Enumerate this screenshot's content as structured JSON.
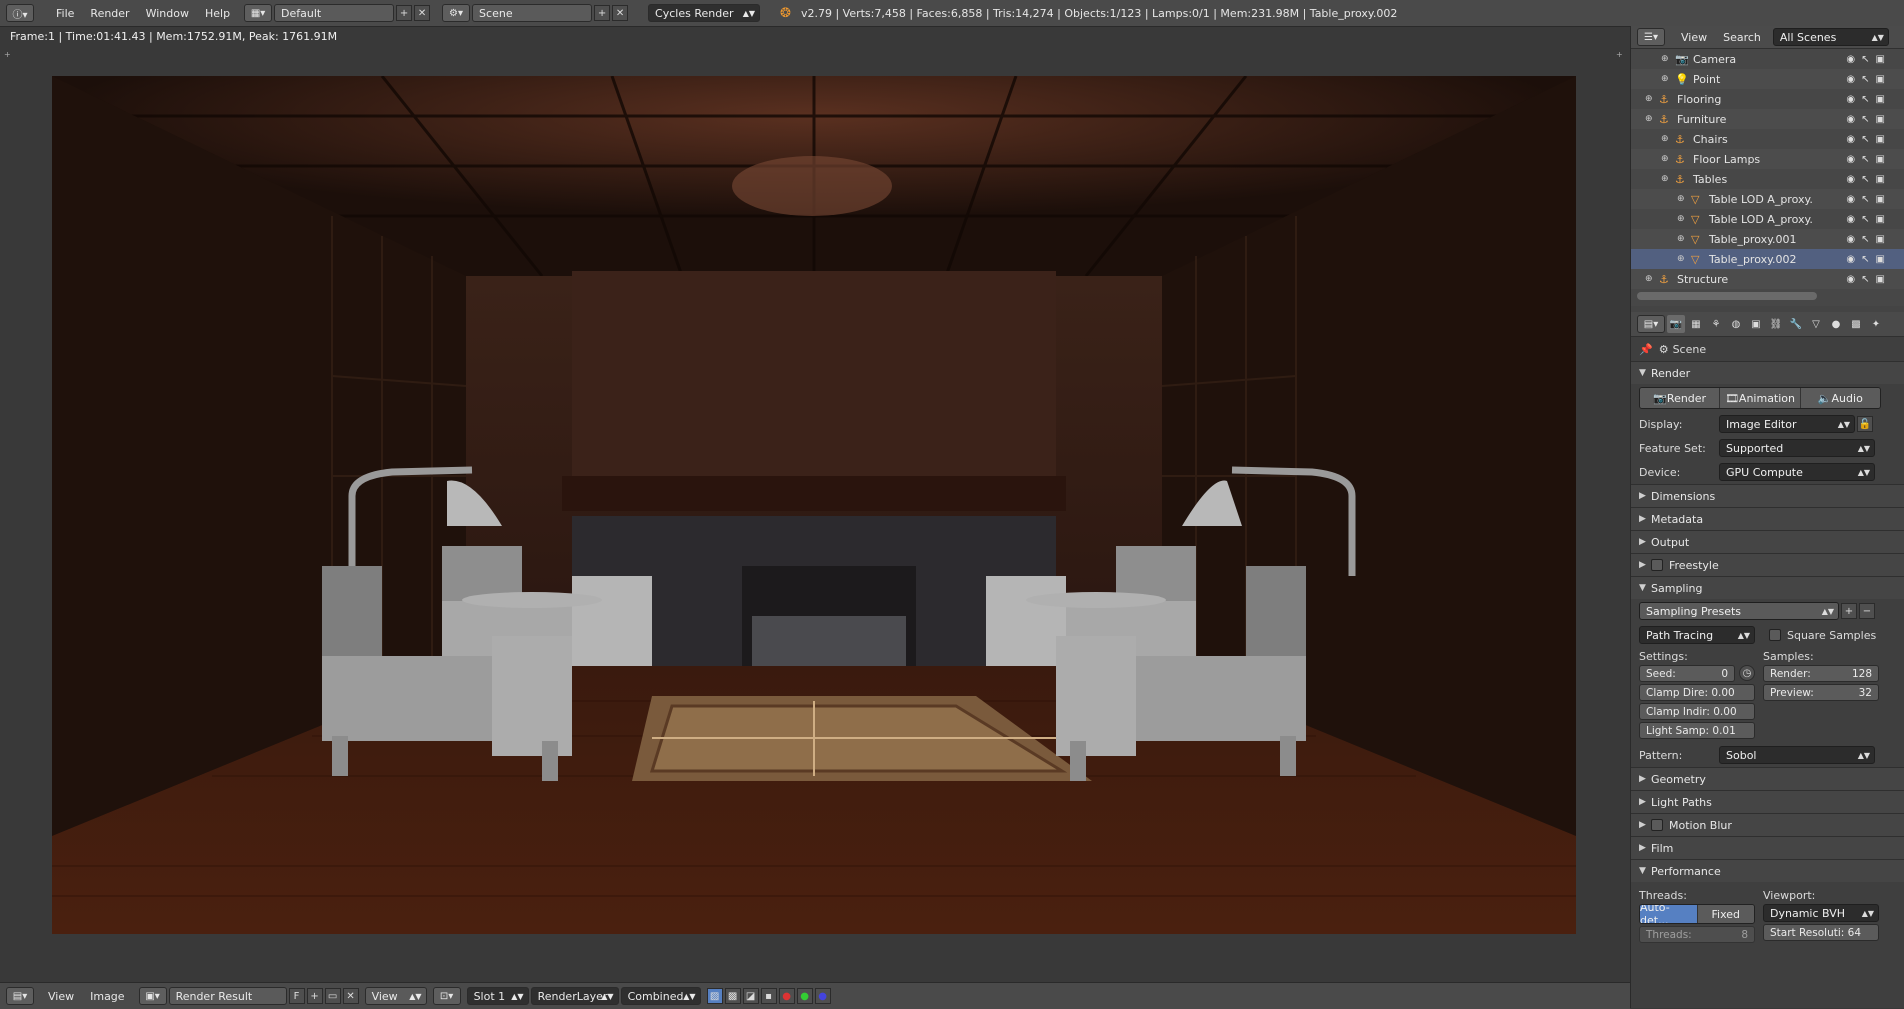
{
  "topbar": {
    "menus": [
      "File",
      "Render",
      "Window",
      "Help"
    ],
    "layout_name": "Default",
    "scene_name": "Scene",
    "engine": "Cycles Render",
    "stats": "v2.79 | Verts:7,458 | Faces:6,858 | Tris:14,274 | Objects:1/123 | Lamps:0/1 | Mem:231.98M | Table_proxy.002"
  },
  "image_editor": {
    "frame_info": "Frame:1 | Time:01:41.43 | Mem:1752.91M, Peak: 1761.91M"
  },
  "bottombar": {
    "view_label": "View",
    "image_label": "Image",
    "image_name": "Render Result",
    "fake_user": "F",
    "view_dropdown": "View",
    "slot": "Slot 1",
    "render_layer": "RenderLayer",
    "pass": "Combined"
  },
  "outliner": {
    "view_label": "View",
    "search_label": "Search",
    "filter": "All Scenes",
    "items": [
      {
        "label": "Camera",
        "indent": 2,
        "icon": "camera-icon"
      },
      {
        "label": "Point",
        "indent": 2,
        "icon": "lamp-icon"
      },
      {
        "label": "Flooring",
        "indent": 1,
        "icon": "empty-icon"
      },
      {
        "label": "Furniture",
        "indent": 1,
        "icon": "empty-icon"
      },
      {
        "label": "Chairs",
        "indent": 2,
        "icon": "empty-icon"
      },
      {
        "label": "Floor Lamps",
        "indent": 2,
        "icon": "empty-icon"
      },
      {
        "label": "Tables",
        "indent": 2,
        "icon": "empty-icon"
      },
      {
        "label": "Table LOD A_proxy.",
        "indent": 3,
        "icon": "mesh-icon"
      },
      {
        "label": "Table LOD A_proxy.",
        "indent": 3,
        "icon": "mesh-icon"
      },
      {
        "label": "Table_proxy.001",
        "indent": 3,
        "icon": "mesh-icon"
      },
      {
        "label": "Table_proxy.002",
        "indent": 3,
        "icon": "mesh-icon"
      },
      {
        "label": "Structure",
        "indent": 1,
        "icon": "empty-icon"
      }
    ]
  },
  "properties": {
    "context": "Scene",
    "render_panel": "Render",
    "render_buttons": [
      "Render",
      "Animation",
      "Audio"
    ],
    "display_label": "Display:",
    "display_value": "Image Editor",
    "feature_set_label": "Feature Set:",
    "feature_set_value": "Supported",
    "device_label": "Device:",
    "device_value": "GPU Compute",
    "collapsed_panels_1": [
      "Dimensions",
      "Metadata",
      "Output",
      "Freestyle"
    ],
    "sampling_panel": "Sampling",
    "sampling_presets": "Sampling Presets",
    "integrator": "Path Tracing",
    "square_samples": "Square Samples",
    "settings_label": "Settings:",
    "samples_label": "Samples:",
    "seed_label": "Seed:",
    "seed_value": "0",
    "clamp_direct": "Clamp Dire: 0.00",
    "clamp_indirect": "Clamp Indir: 0.00",
    "light_sampling": "Light Samp: 0.01",
    "render_samples_label": "Render:",
    "render_samples_value": "128",
    "preview_samples_label": "Preview:",
    "preview_samples_value": "32",
    "pattern_label": "Pattern:",
    "pattern_value": "Sobol",
    "collapsed_panels_2": [
      "Geometry",
      "Light Paths",
      "Motion Blur",
      "Film"
    ],
    "performance_panel": "Performance",
    "threads_label": "Threads:",
    "threads_modes": [
      "Auto-det...",
      "Fixed"
    ],
    "threads_count_label": "Threads:",
    "threads_count_value": "8",
    "viewport_label": "Viewport:",
    "viewport_value": "Dynamic BVH",
    "start_resolution": "Start Resoluti: 64"
  }
}
